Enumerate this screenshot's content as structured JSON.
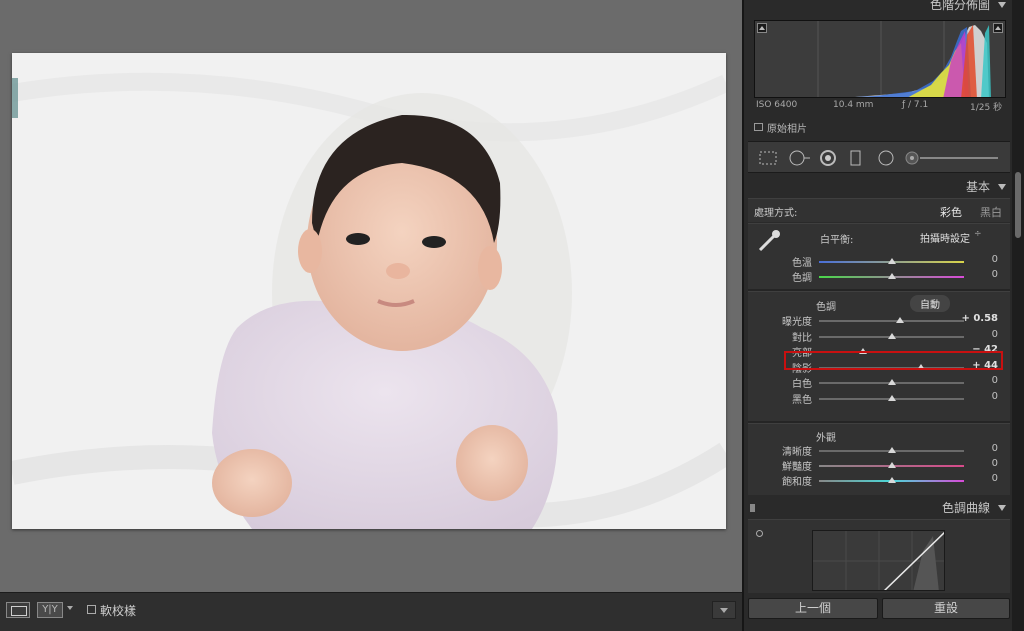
{
  "panel": {
    "histogram": {
      "title": "色階分佈圖",
      "exif": {
        "iso": "ISO 6400",
        "focal": "10.4 mm",
        "aperture": "ƒ / 7.1",
        "shutter": "1/25 秒"
      },
      "original_photo_label": "原始相片"
    },
    "basic": {
      "title": "基本",
      "treatment_label": "處理方式:",
      "treatment_color": "彩色",
      "treatment_bw": "黑白",
      "wb_label": "白平衡:",
      "wb_value": "拍攝時設定",
      "wb_rows": [
        {
          "label": "色溫",
          "value": "0",
          "pos": 0.5
        },
        {
          "label": "色調",
          "value": "0",
          "pos": 0.5
        }
      ],
      "tone_label": "色調",
      "auto_label": "自動",
      "tone_rows": [
        {
          "label": "曝光度",
          "value": "+ 0.58",
          "pos": 0.56
        },
        {
          "label": "對比",
          "value": "0",
          "pos": 0.5
        },
        {
          "label": "亮部",
          "value": "− 42",
          "pos": 0.3
        },
        {
          "label": "陰影",
          "value": "+ 44",
          "pos": 0.7
        },
        {
          "label": "白色",
          "value": "0",
          "pos": 0.5
        },
        {
          "label": "黑色",
          "value": "0",
          "pos": 0.5
        }
      ],
      "presence_label": "外觀",
      "presence_rows": [
        {
          "label": "清晰度",
          "value": "0",
          "pos": 0.5
        },
        {
          "label": "鮮豔度",
          "value": "0",
          "pos": 0.5
        },
        {
          "label": "飽和度",
          "value": "0",
          "pos": 0.5
        }
      ]
    },
    "tone_curve": {
      "title": "色調曲線"
    },
    "buttons": {
      "previous": "上一個",
      "reset": "重設"
    }
  },
  "toolbar": {
    "compare_label": "Y|Y",
    "soft_proof_label": "軟校樣"
  },
  "colors": {
    "highlight_box": "#c81010"
  }
}
